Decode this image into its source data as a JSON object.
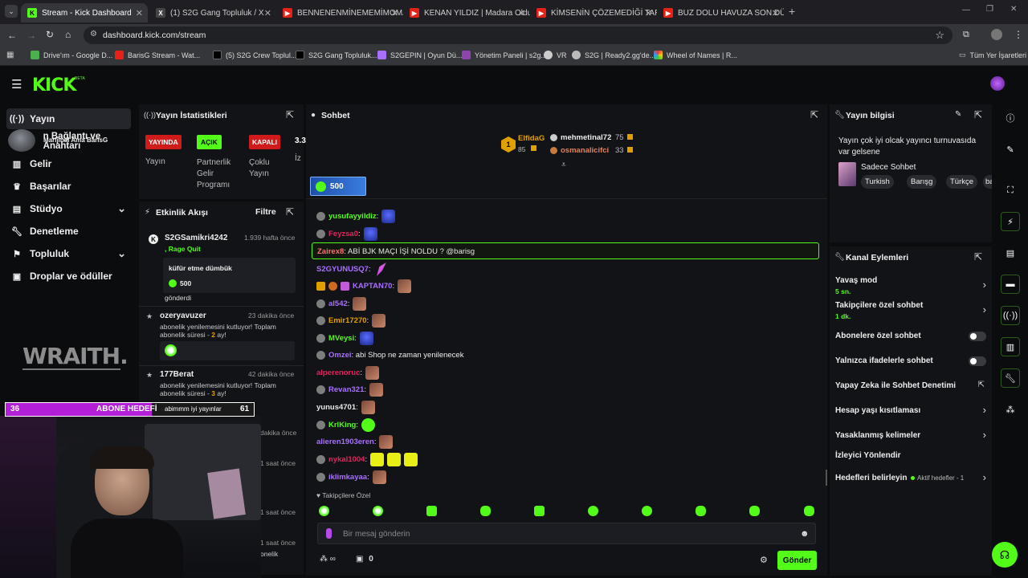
{
  "browser": {
    "tabs": [
      {
        "title": "Stream - Kick Dashboard",
        "icon": "kick-icon"
      },
      {
        "title": "(1) S2G Gang Topluluk / X",
        "icon": "x-icon"
      },
      {
        "title": "BENNENENMİNEMEMİMOMAN",
        "icon": "youtube-icon"
      },
      {
        "title": "KENAN YILDIZ | Madara Olduk",
        "icon": "youtube-icon"
      },
      {
        "title": "KİMSENİN ÇÖZEMEDİĞİ TARİH",
        "icon": "youtube-icon"
      },
      {
        "title": "BUZ DOLU HAVUZA SON DÜŞE",
        "icon": "youtube-icon"
      }
    ],
    "url": "dashboard.kick.com/stream",
    "bookmarks": [
      "Drive'ım - Google D...",
      "BarisG Stream - Wat...",
      "(5) S2G Crew Toplul...",
      "S2G Gang Topluluk...",
      "S2GEPIN | Oyun Dü...",
      "Yönetim Paneli | s2g...",
      "VR",
      "S2G | Ready2.gg'de...",
      "Wheel of Names | R..."
    ],
    "bookmarks_right": "Tüm Yer İşaretleri"
  },
  "kick": {
    "logo": "KICK",
    "logo_badge": "BETA"
  },
  "sidebar": {
    "items": [
      {
        "label": "Yayın",
        "icon": "broadcast-icon"
      },
      {
        "label": "n Bağlantı ve Anahtarı",
        "icon": "key-icon"
      },
      {
        "label": "Gelir",
        "icon": "chart-icon"
      },
      {
        "label": "Başarılar",
        "icon": "trophy-icon"
      },
      {
        "label": "Stüdyo",
        "icon": "studio-icon"
      },
      {
        "label": "Denetleme",
        "icon": "wrench-icon"
      },
      {
        "label": "Topluluk",
        "icon": "community-icon"
      },
      {
        "label": "Droplar ve ödüller",
        "icon": "gift-icon"
      }
    ],
    "overlay_name": "Marijinal Ama BarisG"
  },
  "stream_stats": {
    "title": "Yayın İstatistikleri",
    "badges": [
      {
        "label": "YAYINDA",
        "color": "#d01b1b",
        "caption": "Yayın"
      },
      {
        "label": "AÇIK",
        "color": "#53fc18",
        "caption": "Partnerlik Gelir Programı"
      },
      {
        "label": "KAPALI",
        "color": "#d01b1b",
        "caption": "Çoklu Yayın"
      }
    ],
    "extra_value": "3.3",
    "extra_caption": "İz"
  },
  "activity": {
    "title": "Etkinlik Akışı",
    "filter": "Filtre",
    "items": [
      {
        "user": "S2GSamikri4242",
        "time": "1.939 hafta önce",
        "sub": ", Rage Quit",
        "message": "küfür etme dümbük",
        "amount": "500",
        "footer": "gönderdi"
      },
      {
        "user": "ozeryavuzer",
        "time": "23 dakika önce",
        "text1": "abonelik yenilemesini kutluyor! Toplam",
        "text2": "abonelik süresi - ",
        "months": "2",
        "suffix": " ay!"
      },
      {
        "user": "177Berat",
        "time": "42 dakika önce",
        "text1": "abonelik yenilemesini kutluyor! Toplam",
        "text2": "abonelik süresi - ",
        "months": "3",
        "suffix": " ay!"
      }
    ],
    "hidden_times": [
      "dakika önce",
      "1 saat önce",
      "1 saat önce",
      "1 saat önce"
    ],
    "hidden_tail": "onelik"
  },
  "overlay": {
    "goal_left": "36",
    "goal_label": "ABONE HEDEFİ",
    "goal_right": "61",
    "ticker": "abimmm iyi yayınlar",
    "wraith": "WRAITH."
  },
  "chat": {
    "title": "Sohbet",
    "leaderboard": [
      {
        "name": "ElfidaG",
        "value": "85",
        "rank": "1"
      },
      {
        "name": "mehmetinal72",
        "value": "75"
      },
      {
        "name": "osmanalicifci",
        "value": "33"
      }
    ],
    "pinned_amount": "500",
    "messages": [
      {
        "user": "yusufayyildiz",
        "color": "#53fc18",
        "text": ":",
        "emotes": [
          "eb"
        ]
      },
      {
        "user": "Feyzsa0",
        "color": "#e0245e",
        "text": ":",
        "emotes": [
          "eb"
        ]
      },
      {
        "user": "Zairex8",
        "color": "#ff6f6f",
        "text": ": ABİ BJK MAÇI İŞİ NOLDU ? @barisg",
        "highlight": true
      },
      {
        "user": "S2GYUNUSQ7",
        "color": "#a970ff",
        "text": ":",
        "emotes": [
          "feather"
        ]
      },
      {
        "user": "KAPTAN70",
        "color": "#a970ff",
        "text": ":",
        "emotes": [
          "eg"
        ]
      },
      {
        "user": "al542",
        "color": "#a970ff",
        "text": ":",
        "emotes": [
          "eg"
        ]
      },
      {
        "user": "Emir17270",
        "color": "#e0a000",
        "text": ":",
        "emotes": [
          "eg"
        ]
      },
      {
        "user": "MVeysi",
        "color": "#53fc18",
        "text": ":",
        "emotes": [
          "eb"
        ]
      },
      {
        "user": "Omzei",
        "color": "#a970ff",
        "text": ": abi Shop ne zaman yenilenecek"
      },
      {
        "user": "alperenoruc",
        "color": "#e0245e",
        "text": ":",
        "emotes": [
          "eg"
        ]
      },
      {
        "user": "Revan321",
        "color": "#a970ff",
        "text": ":",
        "emotes": [
          "eg"
        ]
      },
      {
        "user": "yunus4701",
        "color": "#e8e8e8",
        "text": ":",
        "emotes": [
          "eg"
        ]
      },
      {
        "user": "KrlKing",
        "color": "#53fc18",
        "text": ":",
        "emotes": [
          "eg2"
        ]
      },
      {
        "user": "alieren1903eren",
        "color": "#a970ff",
        "text": ":",
        "emotes": [
          "eg"
        ]
      },
      {
        "user": "nykal1004",
        "color": "#e0245e",
        "text": ":",
        "emotes": [
          "ey",
          "ey",
          "ey"
        ]
      },
      {
        "user": "iklimkayaa",
        "color": "#a970ff",
        "text": ":",
        "emotes": [
          "eg"
        ]
      }
    ],
    "emote_bar_label": "Takipçilere Özel",
    "input_placeholder": "Bir mesaj gönderin",
    "footer_count": "0",
    "send": "Gönder"
  },
  "stream_info": {
    "title": "Yayın bilgisi",
    "description": "Yayın çok iyi olcak yayıncı turnuvasıda var gelsene",
    "category": "Sadece Sohbet",
    "tags": [
      "Turkish",
      "Barışg",
      "Türkçe",
      "ba"
    ]
  },
  "channel_actions": {
    "title": "Kanal Eylemleri",
    "items": [
      {
        "label": "Yavaş mod",
        "sub": "5 sn.",
        "type": "chevron"
      },
      {
        "label": "Takipçilere özel sohbet",
        "sub": "1 dk.",
        "type": "chevron"
      },
      {
        "label": "Abonelere özel sohbet",
        "type": "toggle"
      },
      {
        "label": "Yalnızca ifadelerle sohbet",
        "type": "toggle"
      },
      {
        "label": "Yapay Zeka ile Sohbet Denetimi",
        "type": "external"
      },
      {
        "label": "Hesap yaşı kısıtlaması",
        "type": "chevron"
      },
      {
        "label": "Yasaklanmış kelimeler",
        "type": "chevron"
      },
      {
        "label": "İzleyici Yönlendir",
        "type": "none"
      },
      {
        "label": "Hedefleri belirleyin",
        "type": "chevron",
        "status": "Aktif hedefler - 1"
      }
    ]
  },
  "colors": {
    "accent": "#53fc18",
    "live": "#d01b1b"
  }
}
